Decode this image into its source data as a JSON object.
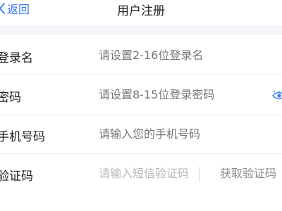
{
  "nav": {
    "back_label": "返回",
    "title": "用户注册"
  },
  "form": {
    "username": {
      "label": "登录名",
      "placeholder": "请设置2-16位登录名"
    },
    "password": {
      "label": "密码",
      "placeholder": "请设置8-15位登录密码",
      "toggle_icon": "eye-icon"
    },
    "phone": {
      "label": "手机号码",
      "placeholder": "请输入您的手机号码"
    },
    "code": {
      "label": "验证码",
      "placeholder": "请输入短信验证码",
      "get_code_label": "获取验证码"
    }
  },
  "colors": {
    "accent": "#3a7bf2",
    "placeholder": "#b8b8b8",
    "label": "#222222",
    "section_gap": "#f4f5f8"
  }
}
